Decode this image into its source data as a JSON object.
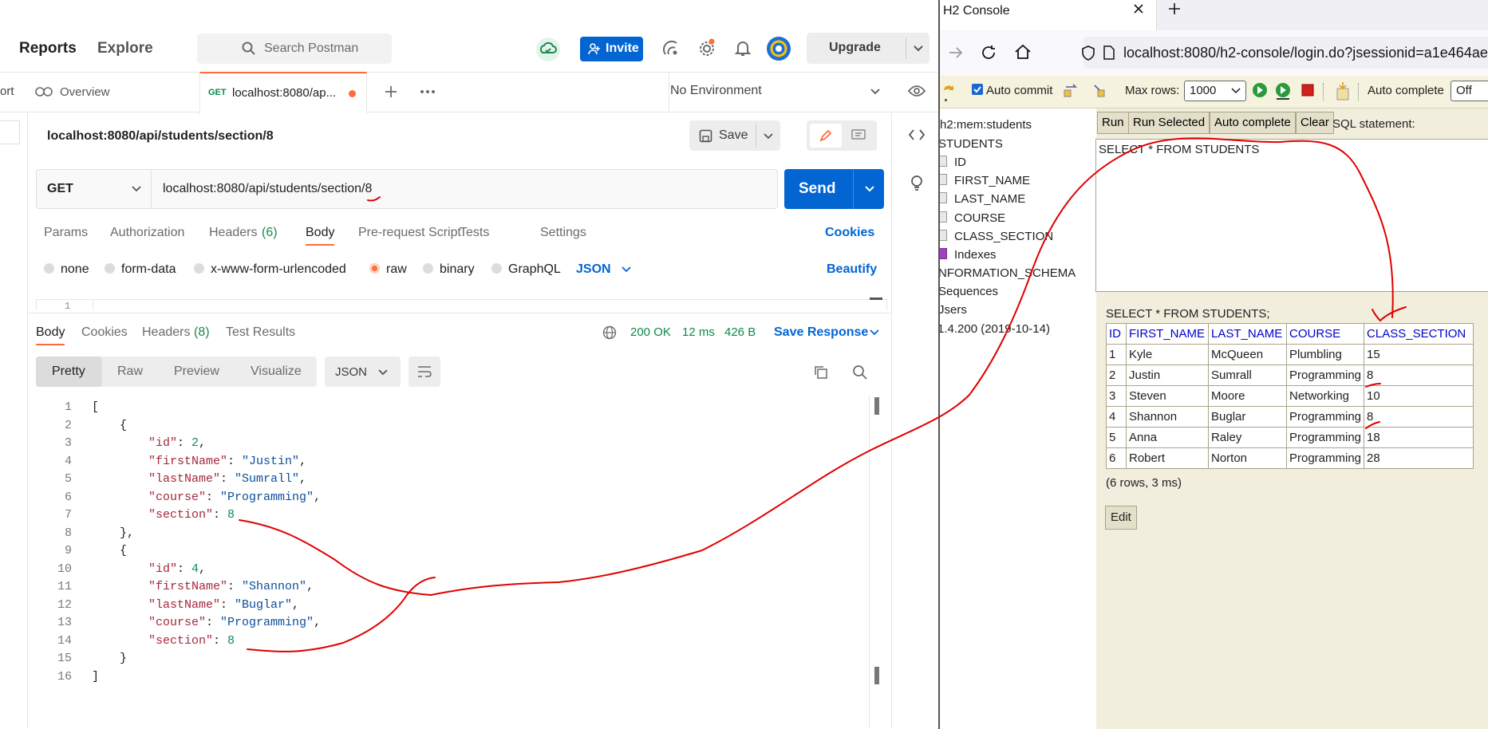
{
  "postman": {
    "nav": {
      "reports": "Reports",
      "explore": "Explore",
      "search_placeholder": "Search Postman",
      "invite": "Invite",
      "upgrade": "Upgrade"
    },
    "tabs": {
      "cut_left": "ort",
      "overview": "Overview",
      "req_method": "GET",
      "req_title": "localhost:8080/ap...",
      "environment": "No Environment"
    },
    "request": {
      "name": "localhost:8080/api/students/section/8",
      "save": "Save",
      "method": "GET",
      "url": "localhost:8080/api/students/section/8",
      "send": "Send",
      "tabs": [
        "Params",
        "Authorization",
        "Headers",
        "(6)",
        "Body",
        "Pre-request Script",
        "Tests",
        "Settings"
      ],
      "cookies": "Cookies",
      "body_types": [
        "none",
        "form-data",
        "x-www-form-urlencoded",
        "raw",
        "binary",
        "GraphQL"
      ],
      "body_format": "JSON",
      "beautify": "Beautify",
      "editor_line": "1"
    },
    "response": {
      "tabs": [
        "Body",
        "Cookies",
        "Headers",
        "(8)",
        "Test Results"
      ],
      "status": "200 OK",
      "time": "12 ms",
      "size": "426 B",
      "save_response": "Save Response",
      "views": [
        "Pretty",
        "Raw",
        "Preview",
        "Visualize"
      ],
      "format": "JSON",
      "line_numbers": [
        "1",
        "2",
        "3",
        "4",
        "5",
        "6",
        "7",
        "8",
        "9",
        "10",
        "11",
        "12",
        "13",
        "14",
        "15",
        "16"
      ],
      "records": [
        {
          "id": "2",
          "firstName": "\"Justin\"",
          "lastName": "\"Sumrall\"",
          "course": "\"Programming\"",
          "section": "8"
        },
        {
          "id": "4",
          "firstName": "\"Shannon\"",
          "lastName": "\"Buglar\"",
          "course": "\"Programming\"",
          "section": "8"
        }
      ],
      "keys": {
        "id": "\"id\"",
        "firstName": "\"firstName\"",
        "lastName": "\"lastName\"",
        "course": "\"course\"",
        "section": "\"section\""
      }
    }
  },
  "browser": {
    "tab_title": "H2 Console",
    "url": "localhost:8080/h2-console/login.do?jsessionid=a1e464ae",
    "toolbar": {
      "auto_commit": "Auto commit",
      "max_rows_label": "Max rows:",
      "max_rows_value": "1000",
      "auto_complete_label": "Auto complete",
      "auto_complete_value": "Off"
    },
    "tree": {
      "db": "h2:mem:students",
      "table": "STUDENTS",
      "columns": [
        "ID",
        "FIRST_NAME",
        "LAST_NAME",
        "COURSE",
        "CLASS_SECTION"
      ],
      "indexes": "Indexes",
      "schema": "NFORMATION_SCHEMA",
      "sequences": "Sequences",
      "users": "Jsers",
      "version": "1.4.200 (2019-10-14)"
    },
    "buttons": {
      "run": "Run",
      "run_selected": "Run Selected",
      "auto_complete": "Auto complete",
      "clear": "Clear",
      "sql_label": "SQL statement:"
    },
    "sql": "SELECT * FROM STUDENTS",
    "result": {
      "query": "SELECT * FROM STUDENTS;",
      "headers": [
        "ID",
        "FIRST_NAME",
        "LAST_NAME",
        "COURSE",
        "CLASS_SECTION"
      ],
      "rows": [
        [
          "1",
          "Kyle",
          "McQueen",
          "Plumbling",
          "15"
        ],
        [
          "2",
          "Justin",
          "Sumrall",
          "Programming",
          "8"
        ],
        [
          "3",
          "Steven",
          "Moore",
          "Networking",
          "10"
        ],
        [
          "4",
          "Shannon",
          "Buglar",
          "Programming",
          "8"
        ],
        [
          "5",
          "Anna",
          "Raley",
          "Programming",
          "18"
        ],
        [
          "6",
          "Robert",
          "Norton",
          "Programming",
          "28"
        ]
      ],
      "summary": "(6 rows, 3 ms)",
      "edit": "Edit"
    }
  },
  "colors": {
    "postman_orange": "#ff6c37",
    "postman_blue": "#0265d2",
    "h2_bg": "#f1eedd",
    "annotation": "#e00000"
  }
}
